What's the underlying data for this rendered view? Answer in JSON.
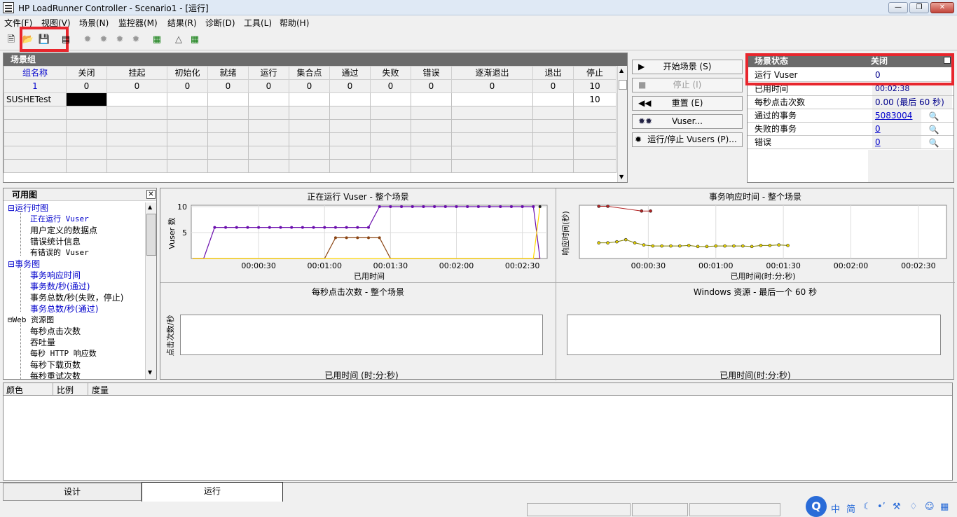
{
  "app": {
    "title": "HP LoadRunner Controller - Scenario1 - [运行]"
  },
  "window": {
    "minimize": "—",
    "maximize": "❐",
    "close": "✕"
  },
  "menu": [
    "文件(F)",
    "视图(V)",
    "场景(N)",
    "监控器(M)",
    "结果(R)",
    "诊断(D)",
    "工具(L)",
    "帮助(H)"
  ],
  "scenario_group": {
    "title": "场景组",
    "headers": [
      "组名称",
      "关闭",
      "挂起",
      "初始化",
      "就绪",
      "运行",
      "集合点",
      "通过",
      "失败",
      "错误",
      "逐渐退出",
      "退出",
      "停止"
    ],
    "totals": [
      "1",
      "0",
      "0",
      "0",
      "0",
      "0",
      "0",
      "0",
      "0",
      "0",
      "0",
      "0",
      "10"
    ],
    "rows": [
      {
        "name": "SUSHETest",
        "stop": "10"
      }
    ]
  },
  "controls": {
    "start": "开始场景 (S)",
    "stop": "停止 (I)",
    "reset": "重置 (E)",
    "vusers": "Vuser...",
    "run_stop": "运行/停止 Vusers (P)..."
  },
  "status": {
    "header_label": "场景状态",
    "header_value": "关闭",
    "rows": [
      {
        "label": "运行 Vuser",
        "value": "0"
      },
      {
        "label": "已用时间",
        "value": "00:02:38 (hh:mm:ss)"
      },
      {
        "label": "每秒点击次数",
        "value": "0.00 (最后 60 秒)"
      },
      {
        "label": "通过的事务",
        "value": "5083004"
      },
      {
        "label": "失败的事务",
        "value": "0"
      },
      {
        "label": "错误",
        "value": "0"
      }
    ]
  },
  "tree": {
    "title": "可用图",
    "items": [
      {
        "text": "运行时图",
        "level": 0
      },
      {
        "text": "正在运行 Vuser",
        "level": 1
      },
      {
        "text": "用户定义的数据点",
        "level": 1
      },
      {
        "text": "错误统计信息",
        "level": 1
      },
      {
        "text": "有错误的 Vuser",
        "level": 1
      },
      {
        "text": "事务图",
        "level": 0
      },
      {
        "text": "事务响应时间",
        "level": 1
      },
      {
        "text": "事务数/秒(通过)",
        "level": 1
      },
      {
        "text": "事务总数/秒(失败，停止)",
        "level": 1
      },
      {
        "text": "事务总数/秒(通过)",
        "level": 1
      },
      {
        "text": "Web 资源图",
        "level": 0
      },
      {
        "text": "每秒点击次数",
        "level": 1
      },
      {
        "text": "吞吐量",
        "level": 1
      },
      {
        "text": "每秒 HTTP 响应数",
        "level": 1
      },
      {
        "text": "每秒下载页数",
        "level": 1
      },
      {
        "text": "每秒重试次数",
        "level": 1
      }
    ]
  },
  "chart_data": [
    {
      "type": "line",
      "title": "正在运行 Vuser - 整个场景",
      "xlabel": "已用时间",
      "ylabel": "Vuser 数",
      "x_ticks": [
        "00:00:30",
        "00:01:00",
        "00:01:30",
        "00:02:00",
        "00:02:30"
      ],
      "y_ticks": [
        "5",
        "10"
      ],
      "ylim": [
        0,
        10
      ],
      "x_seconds": [
        0,
        5,
        10,
        15,
        20,
        25,
        30,
        35,
        40,
        45,
        50,
        55,
        60,
        65,
        70,
        75,
        80,
        85,
        90,
        95,
        100,
        105,
        110,
        115,
        120,
        125,
        130,
        135,
        140,
        145,
        150,
        155,
        158
      ],
      "series": [
        {
          "color": "#6a0dad",
          "values": [
            0,
            0,
            6,
            6,
            6,
            6,
            6,
            6,
            6,
            6,
            6,
            6,
            6,
            6,
            6,
            6,
            6,
            10,
            10,
            10,
            10,
            10,
            10,
            10,
            10,
            10,
            10,
            10,
            10,
            10,
            10,
            10,
            0
          ]
        },
        {
          "color": "#8b4513",
          "values": [
            0,
            0,
            0,
            0,
            0,
            0,
            0,
            0,
            0,
            0,
            0,
            0,
            0,
            4,
            4,
            4,
            4,
            4,
            0,
            0,
            0,
            0,
            0,
            0,
            0,
            0,
            0,
            0,
            0,
            0,
            0,
            0,
            0
          ]
        },
        {
          "color": "#ffd700",
          "values": [
            0,
            0,
            0,
            0,
            0,
            0,
            0,
            0,
            0,
            0,
            0,
            0,
            0,
            0,
            0,
            0,
            0,
            0,
            0,
            0,
            0,
            0,
            0,
            0,
            0,
            0,
            0,
            0,
            0,
            0,
            0,
            0,
            10
          ]
        }
      ]
    },
    {
      "type": "line",
      "title": "事务响应时间 - 整个场景",
      "xlabel": "已用时间(时:分:秒)",
      "ylabel": "响应时间(秒)",
      "x_ticks": [
        "00:00:30",
        "00:01:00",
        "00:01:30",
        "00:02:00",
        "00:02:30"
      ],
      "series": [
        {
          "color": "#b22222",
          "x_seconds": [
            8,
            12,
            27,
            31
          ],
          "values": [
            10,
            10,
            9.1,
            9.1
          ]
        },
        {
          "color": "#808000",
          "x_seconds": [
            8,
            12,
            16,
            20,
            24,
            28,
            32,
            36,
            40,
            44,
            48,
            52,
            56,
            60,
            64,
            68,
            72,
            76,
            80,
            84,
            88,
            92
          ],
          "values": [
            3,
            3,
            3.2,
            3.6,
            3,
            2.6,
            2.4,
            2.4,
            2.4,
            2.4,
            2.5,
            2.3,
            2.3,
            2.4,
            2.4,
            2.4,
            2.4,
            2.3,
            2.5,
            2.5,
            2.6,
            2.5
          ]
        }
      ]
    },
    {
      "type": "line",
      "title": "每秒点击次数 - 整个场景",
      "xlabel": "已用时间 (时:分:秒)",
      "ylabel": "点击次数/秒",
      "series": []
    },
    {
      "type": "line",
      "title": "Windows 资源 - 最后一个 60 秒",
      "xlabel": "已用时间(时:分:秒)",
      "ylabel": "",
      "series": []
    }
  ],
  "legend": {
    "headers": [
      "颜色",
      "比例",
      "度量"
    ]
  },
  "tabs": [
    "设计",
    "运行"
  ],
  "ime": {
    "label": "中",
    "mode": "简"
  }
}
